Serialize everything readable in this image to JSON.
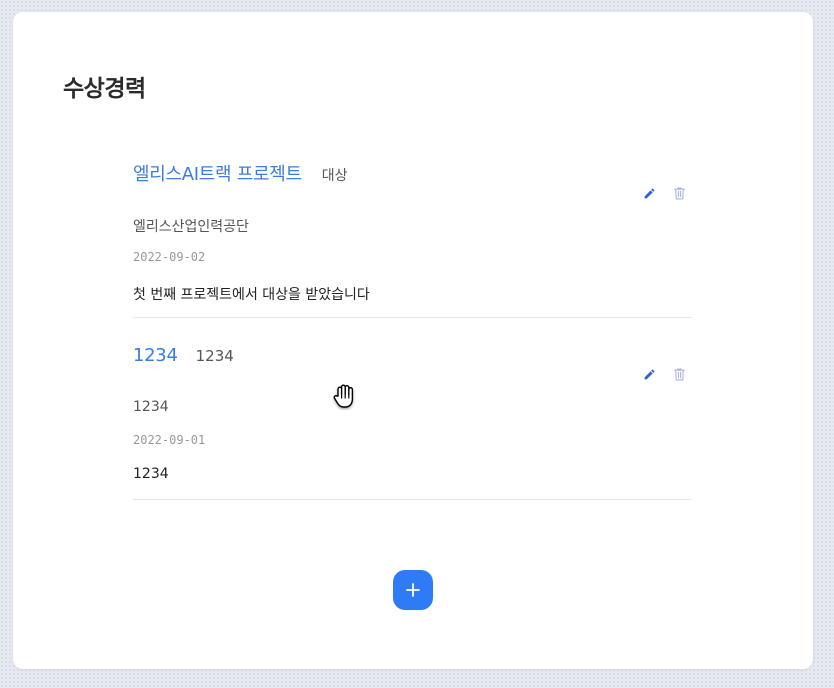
{
  "section": {
    "title": "수상경력"
  },
  "awards": [
    {
      "name": "엘리스AI트랙 프로젝트",
      "grade": "대상",
      "organization": "엘리스산업인력공단",
      "date": "2022-09-02",
      "description": "첫 번째 프로젝트에서 대상을 받았습니다"
    },
    {
      "name": "1234",
      "grade": "1234",
      "organization": "1234",
      "date": "2022-09-01",
      "description": "1234"
    }
  ],
  "icons": {
    "edit": "pencil-icon",
    "delete": "trash-icon",
    "add": "plus-icon",
    "cursor": "hand-cursor-icon"
  },
  "colors": {
    "accent": "#2f7bf5",
    "award_name": "#3b7ddd",
    "edit_icon": "#2f5fd0",
    "delete_icon": "#a9b6d8"
  }
}
